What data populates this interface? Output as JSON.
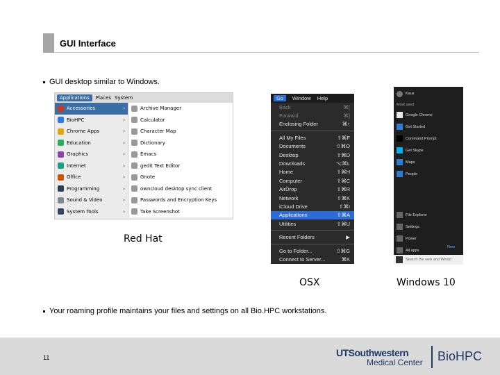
{
  "slide": {
    "title": "GUI Interface",
    "bullet1": "GUI desktop similar to Windows.",
    "bullet2": "Your roaming profile maintains your files and settings on all Bio.HPC workstations.",
    "page_number": "11"
  },
  "captions": {
    "redhat": "Red Hat",
    "osx": "OSX",
    "windows": "Windows 10"
  },
  "redhat_menu": {
    "topbar": [
      "Applications",
      "Places",
      "System"
    ],
    "categories": [
      "Accessories",
      "BioHPC",
      "Chrome Apps",
      "Education",
      "Graphics",
      "Internet",
      "Office",
      "Programming",
      "Sound & Video",
      "System Tools"
    ],
    "items": [
      "Archive Manager",
      "Calculator",
      "Character Map",
      "Dictionary",
      "Emacs",
      "gedit Text Editor",
      "Gnote",
      "owncloud desktop sync client",
      "Passwords and Encryption Keys",
      "Take Screenshot"
    ]
  },
  "osx_menu": {
    "topbar": [
      "Go",
      "Window",
      "Help"
    ],
    "items": [
      {
        "label": "Back",
        "shortcut": "⌘[",
        "dim": true
      },
      {
        "label": "Forward",
        "shortcut": "⌘]",
        "dim": true
      },
      {
        "label": "Enclosing Folder",
        "shortcut": "⌘↑"
      },
      {
        "sep": true
      },
      {
        "label": "All My Files",
        "shortcut": "⇧⌘F"
      },
      {
        "label": "Documents",
        "shortcut": "⇧⌘O"
      },
      {
        "label": "Desktop",
        "shortcut": "⇧⌘D"
      },
      {
        "label": "Downloads",
        "shortcut": "⌥⌘L"
      },
      {
        "label": "Home",
        "shortcut": "⇧⌘H"
      },
      {
        "label": "Computer",
        "shortcut": "⇧⌘C"
      },
      {
        "label": "AirDrop",
        "shortcut": "⇧⌘R"
      },
      {
        "label": "Network",
        "shortcut": "⇧⌘K"
      },
      {
        "label": "iCloud Drive",
        "shortcut": "⇧⌘I"
      },
      {
        "label": "Applications",
        "shortcut": "⇧⌘A",
        "selected": true
      },
      {
        "label": "Utilities",
        "shortcut": "⇧⌘U"
      },
      {
        "sep": true
      },
      {
        "label": "Recent Folders",
        "shortcut": "▶"
      },
      {
        "sep": true
      },
      {
        "label": "Go to Folder...",
        "shortcut": "⇧⌘G"
      },
      {
        "label": "Connect to Server...",
        "shortcut": "⌘K"
      }
    ]
  },
  "windows_menu": {
    "user": "Kaus",
    "section": "Most used",
    "items": [
      "Google Chrome",
      "Get Started",
      "Command Prompt",
      "Get Skype",
      "Maps",
      "People"
    ],
    "bottom": [
      "File Explorer",
      "Settings",
      "Power",
      "All apps"
    ],
    "new_label": "New",
    "search": "Search the web and Windo"
  },
  "logo": {
    "ut": "UTSouthwestern",
    "mc": "Medical Center",
    "bio": "BioHPC"
  },
  "colors": {
    "accent_gray": "#a6a6a6",
    "footer": "#dadada",
    "brand_blue": "#1f3864",
    "osx_select": "#2d6cd6",
    "rh_select": "#3a6ea5"
  }
}
